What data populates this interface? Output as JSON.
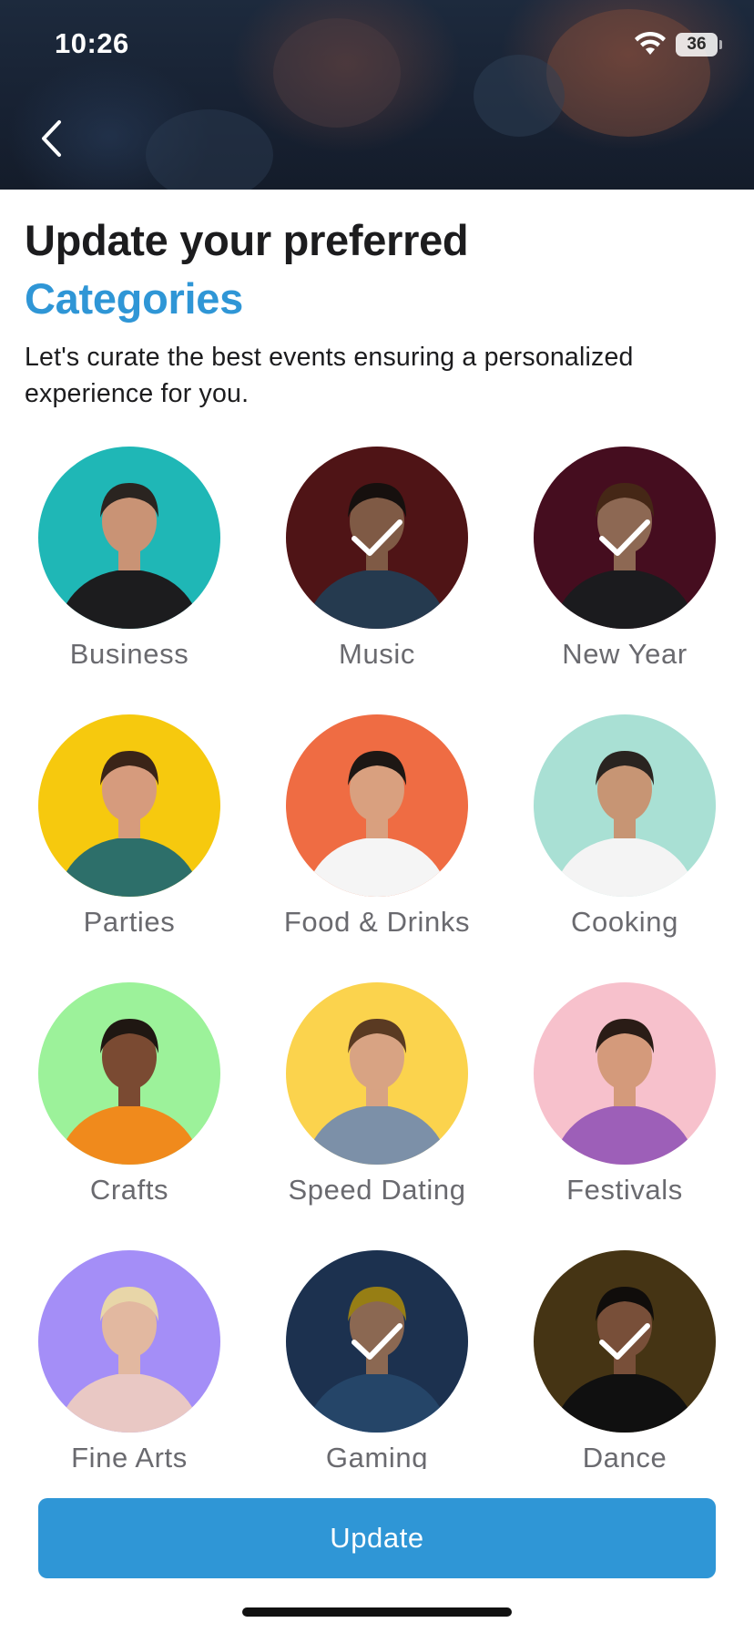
{
  "status_bar": {
    "time": "10:26",
    "battery": "36",
    "wifi_icon": "wifi-icon"
  },
  "header": {
    "back_icon": "chevron-left-icon"
  },
  "title": {
    "line1": "Update your preferred",
    "line2": "Categories",
    "accent_color": "#2f96d6"
  },
  "subtitle": "Let's curate the best events ensuring a personalized experience for you.",
  "categories": [
    {
      "label": "Business",
      "selected": false,
      "bg": "#1fb7b6",
      "skin": "#c99375",
      "hair": "#2a2420",
      "shirt": "#1c1c1e"
    },
    {
      "label": "Music",
      "selected": true,
      "bg": "#7a1f22",
      "skin": "#c48a6a",
      "hair": "#231a16",
      "shirt": "#3a5a7a"
    },
    {
      "label": "New Year",
      "selected": true,
      "bg": "#6b1530",
      "skin": "#d9a080",
      "hair": "#6b3d22",
      "shirt": "#2a2a2e"
    },
    {
      "label": "Parties",
      "selected": false,
      "bg": "#f6c90e",
      "skin": "#d69b7d",
      "hair": "#3a2418",
      "shirt": "#2d6f6a"
    },
    {
      "label": "Food & Drinks",
      "selected": false,
      "bg": "#ef6c43",
      "skin": "#d9a07f",
      "hair": "#1d1714",
      "shirt": "#f5f5f5"
    },
    {
      "label": "Cooking",
      "selected": false,
      "bg": "#a9e0d4",
      "skin": "#c79574",
      "hair": "#2a2420",
      "shirt": "#f4f4f4"
    },
    {
      "label": "Crafts",
      "selected": false,
      "bg": "#9cf29a",
      "skin": "#7a4a32",
      "hair": "#1f1712",
      "shirt": "#f08a1c"
    },
    {
      "label": "Speed Dating",
      "selected": false,
      "bg": "#fbd34d",
      "skin": "#d8a383",
      "hair": "#5a3a22",
      "shirt": "#7c90a8"
    },
    {
      "label": "Festivals",
      "selected": false,
      "bg": "#f7c1cc",
      "skin": "#d49a7b",
      "hair": "#2a1c16",
      "shirt": "#9d5fb8"
    },
    {
      "label": "Fine Arts",
      "selected": false,
      "bg": "#a48ef7",
      "skin": "#e2b8a0",
      "hair": "#e8d6a8",
      "shirt": "#e9c8c4"
    },
    {
      "label": "Gaming",
      "selected": true,
      "bg": "#2b4c7a",
      "skin": "#d6a07f",
      "hair": "#e8c21f",
      "shirt": "#3a6aa0"
    },
    {
      "label": "Dance",
      "selected": true,
      "bg": "#6b5020",
      "skin": "#b97a58",
      "hair": "#1a1411",
      "shirt": "#1a1a1a"
    }
  ],
  "actions": {
    "update_label": "Update",
    "button_color": "#2f96d6"
  },
  "checkmark_icon": "checkmark-icon"
}
